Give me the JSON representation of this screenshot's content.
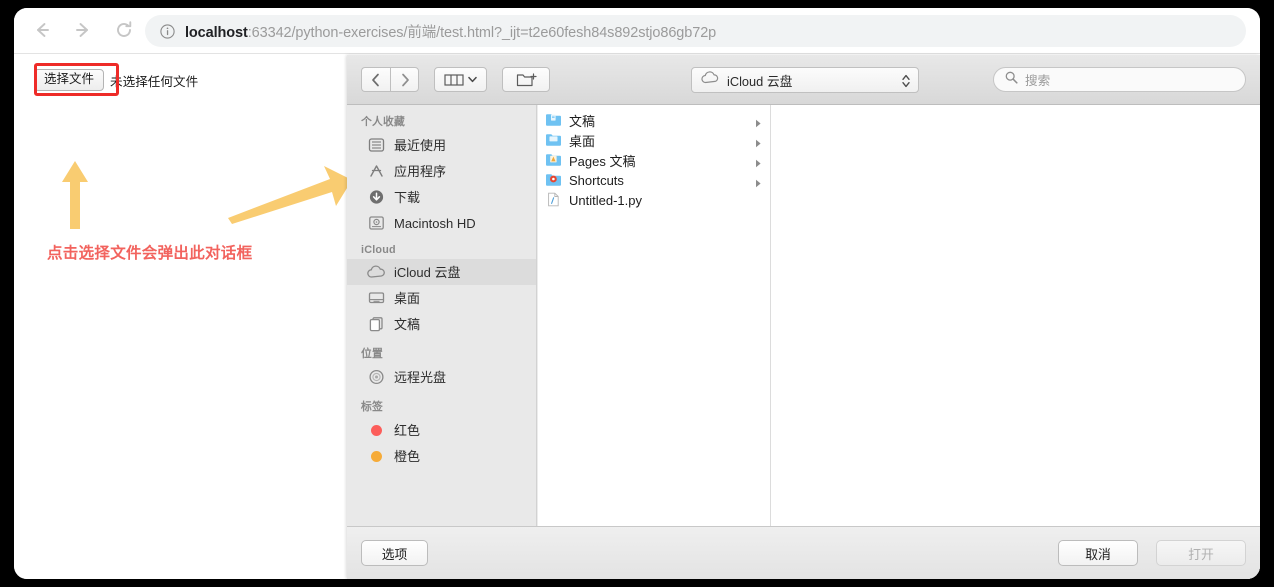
{
  "browser": {
    "nav": {
      "back": "back-arrow",
      "forward": "forward-arrow",
      "reload": "reload"
    },
    "url_prefix": "localhost",
    "url_rest": ":63342/python-exercises/前端/test.html?_ijt=t2e60fesh84s892stjo86gb72p",
    "info_icon": "info-circle-icon"
  },
  "page": {
    "choose_file_label": "选择文件",
    "no_file_label": "未选择任何文件",
    "annotation": "点击选择文件会弹出此对话框",
    "annotation_color": "#f2635e",
    "highlight_color": "#ee2b28",
    "arrow_color": "#f9cc71"
  },
  "dialog": {
    "toolbar": {
      "back": "◀",
      "forward": "▶",
      "view_mode": "column-view",
      "new_folder": "new-folder",
      "path_label": "iCloud 云盘",
      "search_placeholder": "搜索"
    },
    "sidebar": [
      {
        "header": "个人收藏",
        "items": [
          {
            "label": "最近使用",
            "icon": "recents-icon",
            "selected": false
          },
          {
            "label": "应用程序",
            "icon": "applications-icon",
            "selected": false
          },
          {
            "label": "下载",
            "icon": "downloads-icon",
            "selected": false
          },
          {
            "label": "Macintosh HD",
            "icon": "harddisk-icon",
            "selected": false
          }
        ]
      },
      {
        "header": "iCloud",
        "items": [
          {
            "label": "iCloud 云盘",
            "icon": "cloud-icon",
            "selected": true
          },
          {
            "label": "桌面",
            "icon": "desktop-icon",
            "selected": false
          },
          {
            "label": "文稿",
            "icon": "documents-icon",
            "selected": false
          }
        ]
      },
      {
        "header": "位置",
        "items": [
          {
            "label": "远程光盘",
            "icon": "remote-disc-icon",
            "selected": false
          }
        ]
      },
      {
        "header": "标签",
        "items": [
          {
            "label": "红色",
            "icon": "tag-dot",
            "color": "#fc5d5a",
            "selected": false
          },
          {
            "label": "橙色",
            "icon": "tag-dot",
            "color": "#f6ab38",
            "selected": false
          }
        ]
      }
    ],
    "files": [
      {
        "name": "文稿",
        "type": "folder-documents",
        "has_children": true
      },
      {
        "name": "桌面",
        "type": "folder-desktop",
        "has_children": true
      },
      {
        "name": "Pages 文稿",
        "type": "folder-pages",
        "has_children": true
      },
      {
        "name": "Shortcuts",
        "type": "folder-shortcuts",
        "has_children": true
      },
      {
        "name": "Untitled-1.py",
        "type": "file-python",
        "has_children": false
      }
    ],
    "bottom": {
      "options_label": "选项",
      "cancel_label": "取消",
      "open_label": "打开"
    }
  }
}
